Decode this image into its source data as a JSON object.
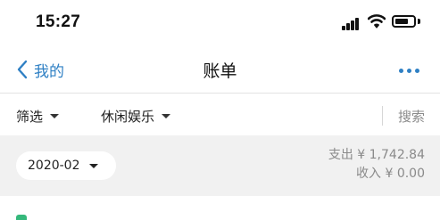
{
  "status_bar": {
    "time": "15:27",
    "icons": [
      "cellular-signal-icon",
      "wifi-icon",
      "battery-icon"
    ]
  },
  "nav": {
    "back_label": "我的",
    "title": "账单",
    "more_icon": "more-dots-icon",
    "accent_color": "#2f80c4"
  },
  "filters": {
    "filter_label": "筛选",
    "category_label": "休闲娱乐",
    "search_label": "搜索"
  },
  "summary": {
    "month": "2020-02",
    "expense_text": "支出 ¥ 1,742.84",
    "income_text": "收入 ¥ 0.00"
  },
  "first_row": {
    "title": "",
    "amount": ""
  }
}
